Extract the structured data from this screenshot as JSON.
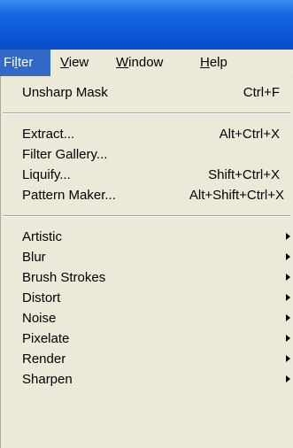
{
  "menubar": {
    "items": [
      {
        "pre": "Fi",
        "key": "l",
        "post": "ter"
      },
      {
        "pre": "",
        "key": "V",
        "post": "iew"
      },
      {
        "pre": "",
        "key": "W",
        "post": "indow"
      },
      {
        "pre": "",
        "key": "H",
        "post": "elp"
      }
    ]
  },
  "filter_menu": {
    "unsharp_mask": {
      "label": "Unsharp Mask",
      "shortcut": "Ctrl+F"
    },
    "extract": {
      "label": "Extract...",
      "shortcut": "Alt+Ctrl+X"
    },
    "filter_gallery": {
      "label": "Filter Gallery..."
    },
    "liquify": {
      "label": "Liquify...",
      "shortcut": "Shift+Ctrl+X"
    },
    "pattern_maker": {
      "label": "Pattern Maker...",
      "shortcut": "Alt+Shift+Ctrl+X"
    },
    "submenus": [
      "Artistic",
      "Blur",
      "Brush Strokes",
      "Distort",
      "Noise",
      "Pixelate",
      "Render",
      "Sharpen"
    ]
  }
}
